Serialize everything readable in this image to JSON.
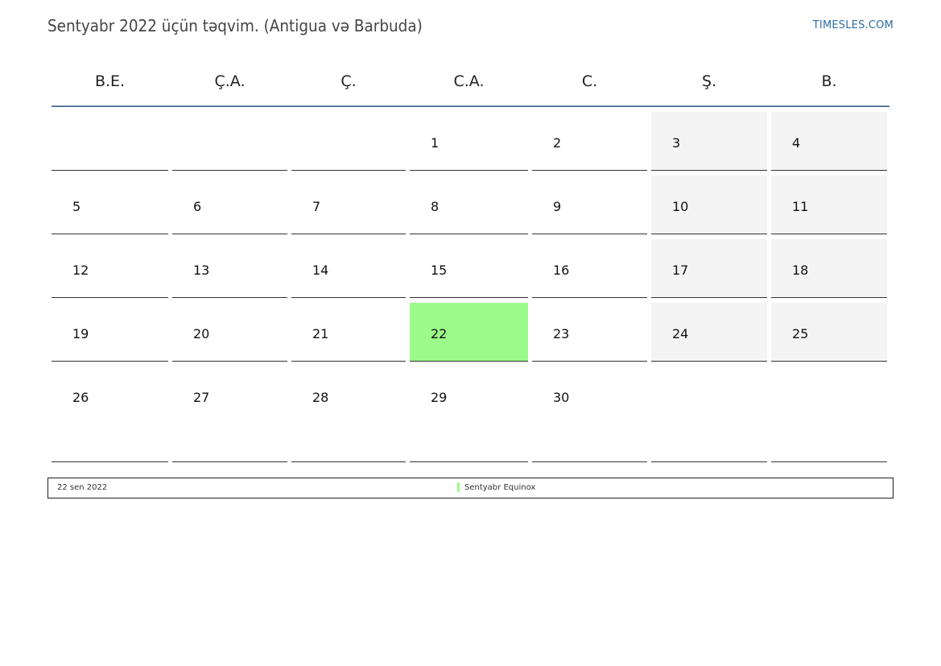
{
  "header": {
    "title": "Sentyabr 2022 üçün təqvim. (Antigua və Barbuda)",
    "brand": "TIMESLES.COM"
  },
  "colors": {
    "holiday": "#9cfc8a",
    "weekend": "#f4f4f4",
    "header_rule": "#5b7a9d",
    "brand": "#2e6da4"
  },
  "weekdays": [
    "B.E.",
    "Ç.A.",
    "Ç.",
    "C.A.",
    "C.",
    "Ş.",
    "B."
  ],
  "weeks": [
    [
      "",
      "",
      "",
      "1",
      "2",
      "3",
      "4"
    ],
    [
      "5",
      "6",
      "7",
      "8",
      "9",
      "10",
      "11"
    ],
    [
      "12",
      "13",
      "14",
      "15",
      "16",
      "17",
      "18"
    ],
    [
      "19",
      "20",
      "21",
      "22",
      "23",
      "24",
      "25"
    ],
    [
      "26",
      "27",
      "28",
      "29",
      "30",
      "",
      ""
    ]
  ],
  "highlighted_day": "22",
  "legend": {
    "date": "22 sen 2022",
    "event": "Sentyabr Equinox"
  }
}
